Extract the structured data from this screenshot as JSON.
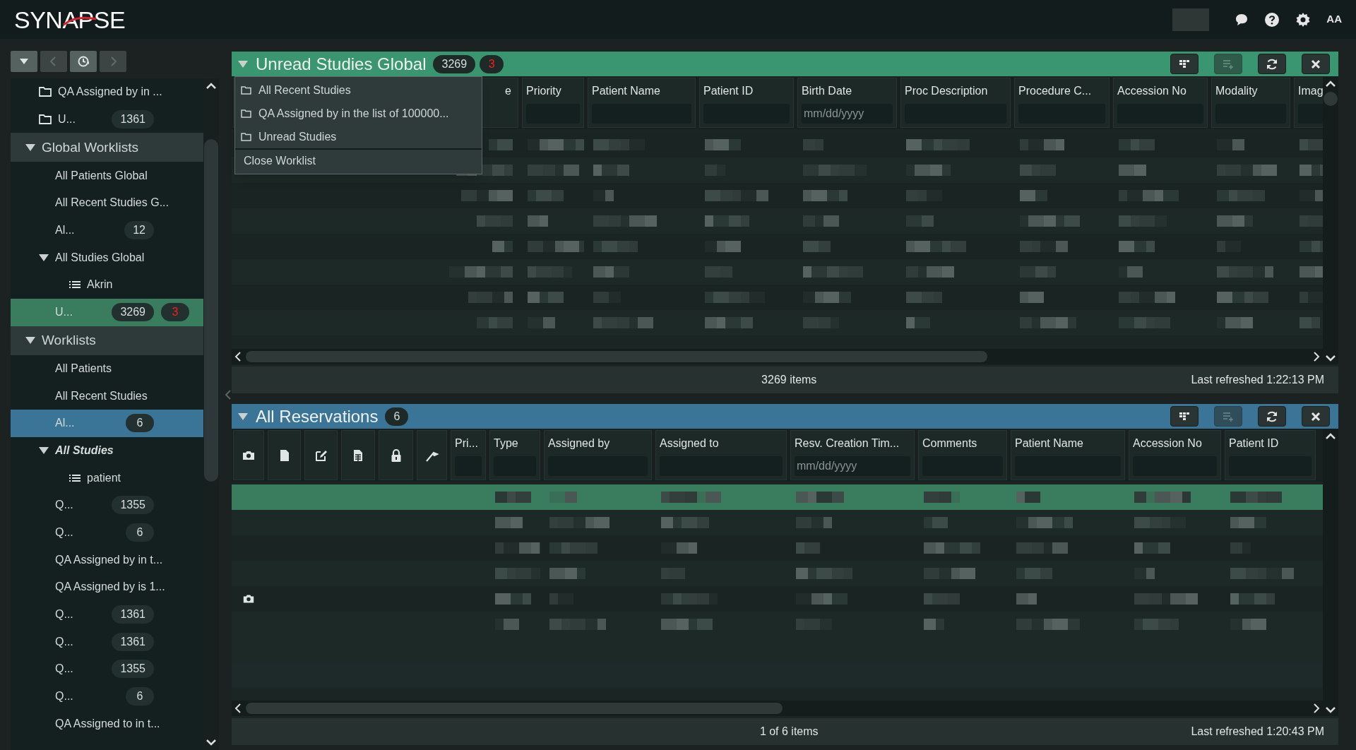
{
  "header": {
    "logo": "SYNAPSE",
    "font_button": "AA"
  },
  "nav_buttons": [
    {
      "disabled": false
    },
    {
      "disabled": true
    },
    {
      "disabled": false
    },
    {
      "disabled": true
    }
  ],
  "sidebar": {
    "items": [
      {
        "kind": "folder",
        "label": "QA Assigned by in ...",
        "selected": false,
        "italic": false
      },
      {
        "kind": "folder",
        "label": "U...",
        "count": "1361",
        "selected": false,
        "italic": false
      },
      {
        "kind": "group",
        "label": "Global Worklists",
        "expanded": true,
        "selected": false,
        "italic": false,
        "children": [
          {
            "kind": "worklist",
            "label": "All Patients Global",
            "selected": false,
            "italic": false
          },
          {
            "kind": "worklist",
            "label": "All Recent Studies G...",
            "selected": false,
            "italic": false
          },
          {
            "kind": "worklist",
            "label": "Al...",
            "count": "12",
            "selected": false,
            "italic": false
          },
          {
            "kind": "node",
            "label": "All Studies Global",
            "expanded": true,
            "selected": false,
            "italic": false,
            "children": [
              {
                "kind": "filter",
                "label": "Akrin",
                "selected": false,
                "italic": false
              }
            ]
          },
          {
            "kind": "worklist",
            "label": "U...",
            "count": "3269",
            "alert_count": "3",
            "selected": true,
            "color": "#3a7d5e",
            "italic": false
          }
        ]
      },
      {
        "kind": "group",
        "label": "Worklists",
        "expanded": true,
        "selected": false,
        "italic": false,
        "children": [
          {
            "kind": "worklist",
            "label": "All Patients",
            "selected": false,
            "italic": false
          },
          {
            "kind": "worklist",
            "label": "All Recent Studies",
            "selected": false,
            "italic": false
          },
          {
            "kind": "worklist",
            "label": "Al...",
            "count": "6",
            "selected": true,
            "color": "#3a7496",
            "italic": false
          },
          {
            "kind": "node",
            "label": "All Studies",
            "expanded": true,
            "selected": false,
            "italic": true,
            "children": [
              {
                "kind": "filter",
                "label": "patient",
                "selected": false,
                "italic": false
              }
            ]
          },
          {
            "kind": "worklist",
            "label": "Q...",
            "count": "1355",
            "selected": false,
            "italic": false
          },
          {
            "kind": "worklist",
            "label": "Q...",
            "count": "6",
            "selected": false,
            "italic": false
          },
          {
            "kind": "worklist",
            "label": "QA Assigned by in t...",
            "selected": false,
            "italic": false
          },
          {
            "kind": "worklist",
            "label": "QA Assigned by is 1...",
            "selected": false,
            "italic": false
          },
          {
            "kind": "worklist",
            "label": "Q...",
            "count": "1361",
            "selected": false,
            "italic": false
          },
          {
            "kind": "worklist",
            "label": "Q...",
            "count": "1361",
            "selected": false,
            "italic": false
          },
          {
            "kind": "worklist",
            "label": "Q...",
            "count": "1355",
            "selected": false,
            "italic": false
          },
          {
            "kind": "worklist",
            "label": "Q...",
            "count": "6",
            "selected": false,
            "italic": false
          },
          {
            "kind": "worklist",
            "label": "QA Assigned to in t...",
            "selected": false,
            "italic": false
          }
        ]
      }
    ]
  },
  "panels": [
    {
      "title": "Unread Studies Global",
      "count": "3269",
      "alert_count": "3",
      "color": "#3a9670",
      "tools": [
        {
          "disabled": false
        },
        {
          "disabled": true
        },
        {
          "disabled": false
        },
        {
          "disabled": false
        }
      ],
      "menu": {
        "items": [
          {
            "kind": "folder",
            "label": "All Recent Studies"
          },
          {
            "kind": "folder",
            "label": "QA Assigned by in the list of 100000..."
          },
          {
            "kind": "folder",
            "label": "Unread Studies"
          },
          {
            "kind": "action",
            "label": "Close Worklist"
          }
        ]
      },
      "columns": [
        {
          "kind": "text",
          "label": "e"
        },
        {
          "kind": "text",
          "label": "Priority"
        },
        {
          "kind": "text",
          "label": "Patient Name"
        },
        {
          "kind": "text",
          "label": "Patient ID"
        },
        {
          "kind": "text",
          "label": "Birth Date",
          "placeholder": "mm/dd/yyyy"
        },
        {
          "kind": "text",
          "label": "Proc Description"
        },
        {
          "kind": "text",
          "label": "Procedure C..."
        },
        {
          "kind": "text",
          "label": "Accession No"
        },
        {
          "kind": "text",
          "label": "Modality"
        },
        {
          "kind": "text",
          "label": "Imag"
        }
      ],
      "rows": [
        {
          "selected": false
        },
        {
          "selected": false
        },
        {
          "selected": false
        },
        {
          "selected": false
        },
        {
          "selected": false
        },
        {
          "selected": false
        },
        {
          "selected": false
        },
        {
          "selected": false
        }
      ],
      "footer": {
        "items": "3269 items",
        "refreshed": "Last refreshed 1:22:13 PM"
      }
    },
    {
      "title": "All Reservations",
      "count": "6",
      "color": "#3a7496",
      "tools": [
        {
          "disabled": false
        },
        {
          "disabled": true
        },
        {
          "disabled": false
        },
        {
          "disabled": false
        }
      ],
      "columns": [
        {
          "kind": "icon"
        },
        {
          "kind": "icon"
        },
        {
          "kind": "icon"
        },
        {
          "kind": "icon"
        },
        {
          "kind": "icon"
        },
        {
          "kind": "icon"
        },
        {
          "kind": "text",
          "label": "Pri..."
        },
        {
          "kind": "text",
          "label": "Type"
        },
        {
          "kind": "text",
          "label": "Assigned by"
        },
        {
          "kind": "text",
          "label": "Assigned to"
        },
        {
          "kind": "text",
          "label": "Resv. Creation Tim...",
          "placeholder": "mm/dd/yyyy"
        },
        {
          "kind": "text",
          "label": "Comments"
        },
        {
          "kind": "text",
          "label": "Patient Name"
        },
        {
          "kind": "text",
          "label": "Accession No"
        },
        {
          "kind": "text",
          "label": "Patient ID"
        }
      ],
      "rows": [
        {
          "selected": true,
          "has_image": false
        },
        {
          "selected": false,
          "has_image": false
        },
        {
          "selected": false,
          "has_image": false
        },
        {
          "selected": false,
          "has_image": false
        },
        {
          "selected": false,
          "has_image": true
        },
        {
          "selected": false,
          "has_image": false
        }
      ],
      "footer": {
        "items": "1 of 6 items",
        "refreshed": "Last refreshed 1:20:43 PM"
      }
    }
  ]
}
